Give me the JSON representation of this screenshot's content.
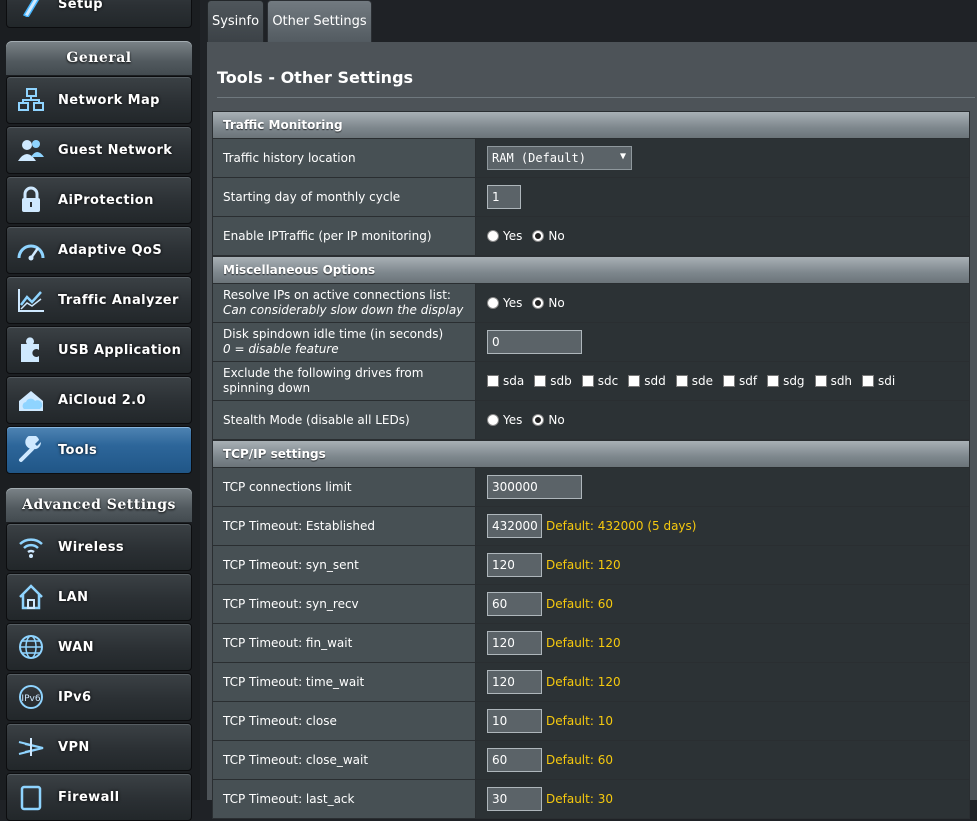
{
  "sidebar": {
    "setup_label": "Setup",
    "general_header": "General",
    "general_items": [
      {
        "label": "Network Map",
        "icon": "network-map-icon"
      },
      {
        "label": "Guest Network",
        "icon": "guest-network-icon"
      },
      {
        "label": "AiProtection",
        "icon": "lock-icon"
      },
      {
        "label": "Adaptive QoS",
        "icon": "speedometer-icon"
      },
      {
        "label": "Traffic Analyzer",
        "icon": "chart-icon"
      },
      {
        "label": "USB Application",
        "icon": "puzzle-icon"
      },
      {
        "label": "AiCloud 2.0",
        "icon": "cloud-icon"
      },
      {
        "label": "Tools",
        "icon": "wrench-icon"
      }
    ],
    "advanced_header": "Advanced Settings",
    "advanced_items": [
      {
        "label": "Wireless",
        "icon": "wifi-icon"
      },
      {
        "label": "LAN",
        "icon": "home-icon"
      },
      {
        "label": "WAN",
        "icon": "globe-icon"
      },
      {
        "label": "IPv6",
        "icon": "ipv6-icon"
      },
      {
        "label": "VPN",
        "icon": "vpn-icon"
      },
      {
        "label": "Firewall",
        "icon": "firewall-icon"
      }
    ],
    "active_item": "Tools"
  },
  "tabs": [
    {
      "label": "Sysinfo",
      "active": false
    },
    {
      "label": "Other Settings",
      "active": true
    }
  ],
  "page_title": "Tools - Other Settings",
  "traffic_monitoring": {
    "header": "Traffic Monitoring",
    "history_location_label": "Traffic history location",
    "history_location_value": "RAM (Default)",
    "start_day_label": "Starting day of monthly cycle",
    "start_day_value": "1",
    "iptraffic_label": "Enable IPTraffic (per IP monitoring)",
    "iptraffic_yes": "Yes",
    "iptraffic_no": "No",
    "iptraffic_selected": "No"
  },
  "misc": {
    "header": "Miscellaneous Options",
    "resolve_label": "Resolve IPs on active connections list:",
    "resolve_sub": "Can considerably slow down the display",
    "resolve_yes": "Yes",
    "resolve_no": "No",
    "resolve_selected": "No",
    "spindown_label": "Disk spindown idle time (in seconds)",
    "spindown_sub": "0 = disable feature",
    "spindown_value": "0",
    "exclude_label": "Exclude the following drives from spinning down",
    "drives": [
      "sda",
      "sdb",
      "sdc",
      "sdd",
      "sde",
      "sdf",
      "sdg",
      "sdh",
      "sdi"
    ],
    "stealth_label": "Stealth Mode (disable all LEDs)",
    "stealth_yes": "Yes",
    "stealth_no": "No",
    "stealth_selected": "No"
  },
  "tcpip": {
    "header": "TCP/IP settings",
    "conn_limit_label": "TCP connections limit",
    "conn_limit_value": "300000",
    "timeouts": [
      {
        "label": "TCP Timeout: Established",
        "value": "432000",
        "hint": "Default: 432000 (5 days)"
      },
      {
        "label": "TCP Timeout: syn_sent",
        "value": "120",
        "hint": "Default: 120"
      },
      {
        "label": "TCP Timeout: syn_recv",
        "value": "60",
        "hint": "Default: 60"
      },
      {
        "label": "TCP Timeout: fin_wait",
        "value": "120",
        "hint": "Default: 120"
      },
      {
        "label": "TCP Timeout: time_wait",
        "value": "120",
        "hint": "Default: 120"
      },
      {
        "label": "TCP Timeout: close",
        "value": "10",
        "hint": "Default: 10"
      },
      {
        "label": "TCP Timeout: close_wait",
        "value": "60",
        "hint": "Default: 60"
      },
      {
        "label": "TCP Timeout: last_ack",
        "value": "30",
        "hint": "Default: 30"
      }
    ]
  },
  "colors": {
    "accent_active_nav": "#2d669a",
    "hint_text": "#f6c90e",
    "panel_bg": "#4d5358"
  }
}
